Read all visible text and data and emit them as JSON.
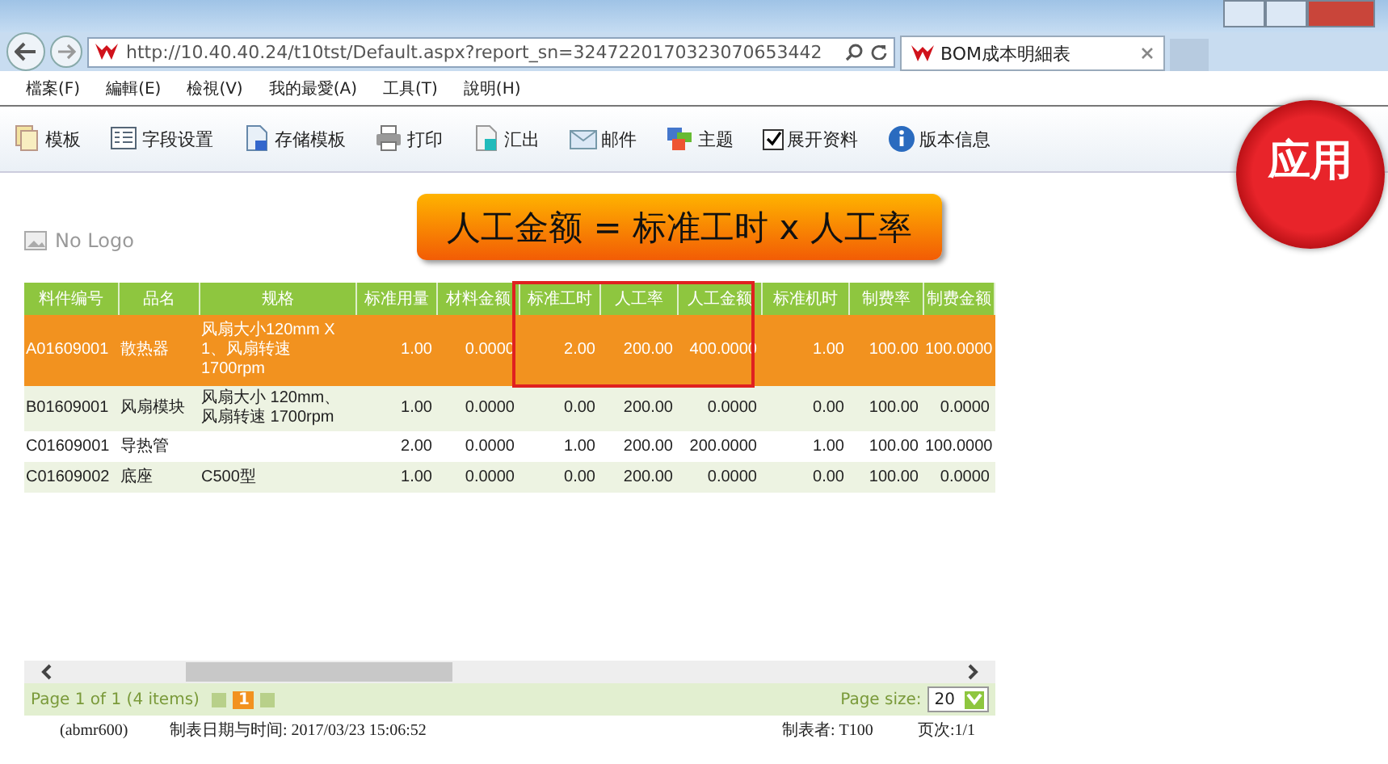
{
  "browser": {
    "address": "http://10.40.40.24/t10tst/Default.aspx?report_sn=3247220170323070653442",
    "tab_title": "BOM成本明細表"
  },
  "menu": [
    "檔案(F)",
    "編輯(E)",
    "檢視(V)",
    "我的最愛(A)",
    "工具(T)",
    "說明(H)"
  ],
  "toolbar": [
    {
      "kind": "button",
      "label": "模板"
    },
    {
      "kind": "button",
      "label": "字段设置"
    },
    {
      "kind": "button",
      "label": "存储模板"
    },
    {
      "kind": "button",
      "label": "打印"
    },
    {
      "kind": "button",
      "label": "汇出"
    },
    {
      "kind": "button",
      "label": "邮件"
    },
    {
      "kind": "button",
      "label": "主题"
    },
    {
      "kind": "checkbox",
      "label": "展开资料",
      "checked": true
    },
    {
      "kind": "button",
      "label": "版本信息"
    }
  ],
  "badge": "应用",
  "logo": "No Logo",
  "callout": "人工金额 = 标准工时 x 人工率",
  "table": {
    "columns": [
      "料件编号",
      "品名",
      "规格",
      "标准用量",
      "材料金额",
      "标准工时",
      "人工率",
      "人工金额",
      "标准机时",
      "制费率",
      "制费金额"
    ],
    "rows": [
      {
        "selected": true,
        "cells": [
          "A01609001",
          "散热器",
          "风扇大小120mm X 1、风扇转速 1700rpm",
          "1.00",
          "0.0000",
          "2.00",
          "200.00",
          "400.0000",
          "1.00",
          "100.00",
          "100.0000"
        ]
      },
      {
        "selected": false,
        "cells": [
          "B01609001",
          "风扇模块",
          "风扇大小 120mm、风扇转速 1700rpm",
          "1.00",
          "0.0000",
          "0.00",
          "200.00",
          "0.0000",
          "0.00",
          "100.00",
          "0.0000"
        ]
      },
      {
        "selected": false,
        "cells": [
          "C01609001",
          "导热管",
          "",
          "2.00",
          "0.0000",
          "1.00",
          "200.00",
          "200.0000",
          "1.00",
          "100.00",
          "100.0000"
        ]
      },
      {
        "selected": false,
        "cells": [
          "C01609002",
          "底座",
          "C500型",
          "1.00",
          "0.0000",
          "0.00",
          "200.00",
          "0.0000",
          "0.00",
          "100.00",
          "0.0000"
        ]
      }
    ]
  },
  "pager": {
    "summary": "Page 1 of 1 (4 items)",
    "current_page": "1",
    "page_size_label": "Page size:",
    "page_size": "20"
  },
  "footer": [
    "(abmr600)",
    "制表日期与时间: 2017/03/23 15:06:52",
    "制表者: T100",
    "页次:1/1"
  ]
}
